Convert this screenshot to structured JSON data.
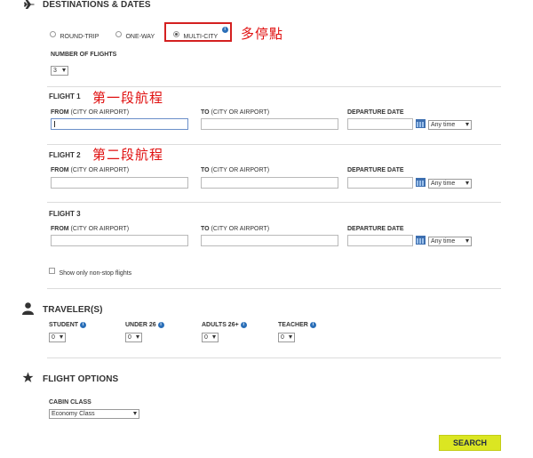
{
  "destinations": {
    "title": "DESTINATIONS & DATES",
    "trip_types": [
      "ROUND-TRIP",
      "ONE-WAY",
      "MULTI-CITY"
    ],
    "selected": "MULTI-CITY"
  },
  "annotations": {
    "multi_city": "多停點",
    "flight1": "第一段航程",
    "flight2": "第二段航程"
  },
  "number_of_flights": {
    "label": "NUMBER OF FLIGHTS",
    "value": "3"
  },
  "labels": {
    "from_bold": "FROM",
    "from_rest": " (CITY OR AIRPORT)",
    "to_bold": "TO",
    "to_rest": " (CITY OR AIRPORT)",
    "departure": "DEPARTURE DATE",
    "any_time": "Any time"
  },
  "flights": [
    {
      "title": "FLIGHT 1"
    },
    {
      "title": "FLIGHT 2"
    },
    {
      "title": "FLIGHT 3"
    }
  ],
  "nonstop_label": "Show only non-stop flights",
  "travelers": {
    "title": "TRAVELER(S)",
    "groups": [
      {
        "label": "STUDENT",
        "value": "0"
      },
      {
        "label": "UNDER 26",
        "value": "0"
      },
      {
        "label": "ADULTS 26+",
        "value": "0"
      },
      {
        "label": "TEACHER",
        "value": "0"
      }
    ]
  },
  "flight_options": {
    "title": "FLIGHT OPTIONS",
    "cabin_label": "CABIN CLASS",
    "cabin_value": "Economy Class"
  },
  "search_label": "SEARCH",
  "colors": {
    "accent": "#dbe622",
    "info": "#2a6fb8",
    "annotation": "#e01010"
  },
  "icons": {
    "destinations": "airplane-icon",
    "travelers": "person-icon",
    "options": "star-icon"
  }
}
